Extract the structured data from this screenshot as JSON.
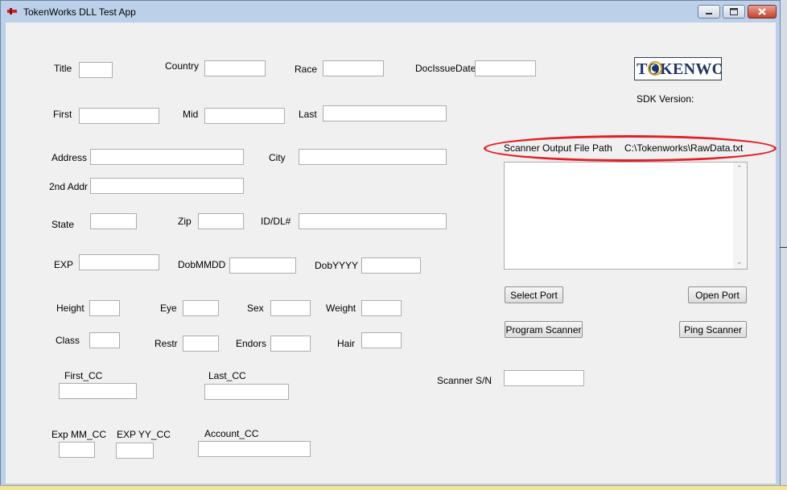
{
  "window": {
    "title": "TokenWorks DLL Test App"
  },
  "fields": {
    "title": {
      "label": "Title",
      "value": ""
    },
    "country": {
      "label": "Country",
      "value": ""
    },
    "race": {
      "label": "Race",
      "value": ""
    },
    "doc_issue_date": {
      "label": "DocIssueDate",
      "value": ""
    },
    "first": {
      "label": "First",
      "value": ""
    },
    "mid": {
      "label": "Mid",
      "value": ""
    },
    "last": {
      "label": "Last",
      "value": ""
    },
    "address": {
      "label": "Address",
      "value": ""
    },
    "city": {
      "label": "City",
      "value": ""
    },
    "address2": {
      "label": "2nd Addr",
      "value": ""
    },
    "state": {
      "label": "State",
      "value": ""
    },
    "zip": {
      "label": "Zip",
      "value": ""
    },
    "id_dl": {
      "label": "ID/DL#",
      "value": ""
    },
    "exp": {
      "label": "EXP",
      "value": ""
    },
    "dob_mmdd": {
      "label": "DobMMDD",
      "value": ""
    },
    "dob_yyyy": {
      "label": "DobYYYY",
      "value": ""
    },
    "height": {
      "label": "Height",
      "value": ""
    },
    "eye": {
      "label": "Eye",
      "value": ""
    },
    "sex": {
      "label": "Sex",
      "value": ""
    },
    "weight": {
      "label": "Weight",
      "value": ""
    },
    "class": {
      "label": "Class",
      "value": ""
    },
    "restr": {
      "label": "Restr",
      "value": ""
    },
    "endors": {
      "label": "Endors",
      "value": ""
    },
    "hair": {
      "label": "Hair",
      "value": ""
    },
    "first_cc": {
      "label": "First_CC",
      "value": ""
    },
    "last_cc": {
      "label": "Last_CC",
      "value": ""
    },
    "exp_mm_cc": {
      "label": "Exp MM_CC",
      "value": ""
    },
    "exp_yy_cc": {
      "label": "EXP YY_CC",
      "value": ""
    },
    "account_cc": {
      "label": "Account_CC",
      "value": ""
    },
    "scanner_sn": {
      "label": "Scanner S/N",
      "value": ""
    }
  },
  "logo": {
    "text": "TOKENWOR"
  },
  "sdk": {
    "label": "SDK Version:",
    "value": ""
  },
  "output": {
    "label": "Scanner Output File Path",
    "path": "C:\\Tokenworks\\RawData.txt",
    "content": ""
  },
  "buttons": {
    "select_port": "Select Port",
    "open_port": "Open Port",
    "program_scanner": "Program Scanner",
    "ping_scanner": "Ping Scanner"
  },
  "icons": {
    "app_icon": "app-icon",
    "minimize": "minimize-icon",
    "maximize": "maximize-icon",
    "close": "close-icon"
  },
  "colors": {
    "highlight": "#e31e24",
    "logo_text": "#1f3563",
    "client_bg": "#f0f0f0"
  }
}
